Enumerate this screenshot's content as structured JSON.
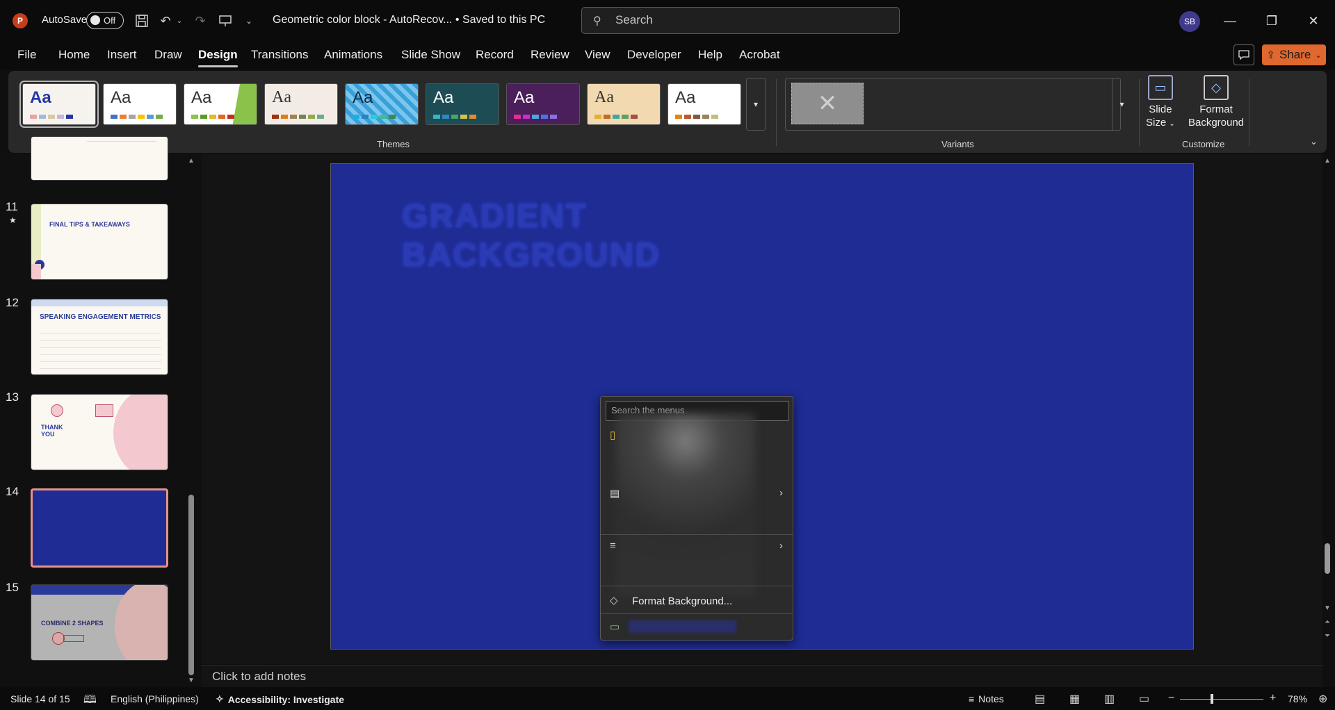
{
  "titlebar": {
    "app_logo": "P",
    "autosave_label": "AutoSave",
    "autosave_state": "Off",
    "doc_title": "Geometric color block  -  AutoRecov...  •  Saved to this PC",
    "search_placeholder": "Search",
    "user_initials": "SB",
    "icons": [
      "save-icon",
      "undo-icon",
      "redo-icon",
      "present-from-beginning-icon",
      "customize-qat-icon"
    ]
  },
  "tabs": [
    {
      "label": "File"
    },
    {
      "label": "Home"
    },
    {
      "label": "Insert"
    },
    {
      "label": "Draw"
    },
    {
      "label": "Design"
    },
    {
      "label": "Transitions"
    },
    {
      "label": "Animations"
    },
    {
      "label": "Slide Show"
    },
    {
      "label": "Record"
    },
    {
      "label": "Review"
    },
    {
      "label": "View"
    },
    {
      "label": "Developer"
    },
    {
      "label": "Help"
    },
    {
      "label": "Acrobat"
    }
  ],
  "active_tab": "Design",
  "share_label": "Share",
  "ribbon": {
    "themes_group_label": "Themes",
    "variants_group_label": "Variants",
    "customize_group_label": "Customize",
    "theme_aa": "Aa",
    "slide_size_label_1": "Slide",
    "slide_size_label_2": "Size",
    "format_background_label_1": "Format",
    "format_background_label_2": "Background"
  },
  "slides": {
    "numbers": [
      "11",
      "12",
      "13",
      "14",
      "15"
    ],
    "titles": [
      "FINAL TIPS & TAKEAWAYS",
      "SPEAKING ENGAGEMENT METRICS",
      "THANK YOU",
      "",
      "COMBINE 2 SHAPES"
    ]
  },
  "slide_canvas": {
    "heading_line1": "GRADIENT",
    "heading_line2": "BACKGROUND",
    "background_color": "#1f2c94"
  },
  "notes_placeholder": "Click to add notes",
  "context_menu": {
    "search_placeholder": "Search the menus",
    "format_background_label": "Format Background..."
  },
  "statusbar": {
    "slide_info": "Slide 14 of 15",
    "language": "English (Philippines)",
    "accessibility": "Accessibility: Investigate",
    "notes_label": "Notes",
    "zoom_level": "78%",
    "zoom_fraction": 0.37
  },
  "colors": {
    "accent_share": "#e0682f",
    "selected_thumb_border": "#e9928a"
  }
}
